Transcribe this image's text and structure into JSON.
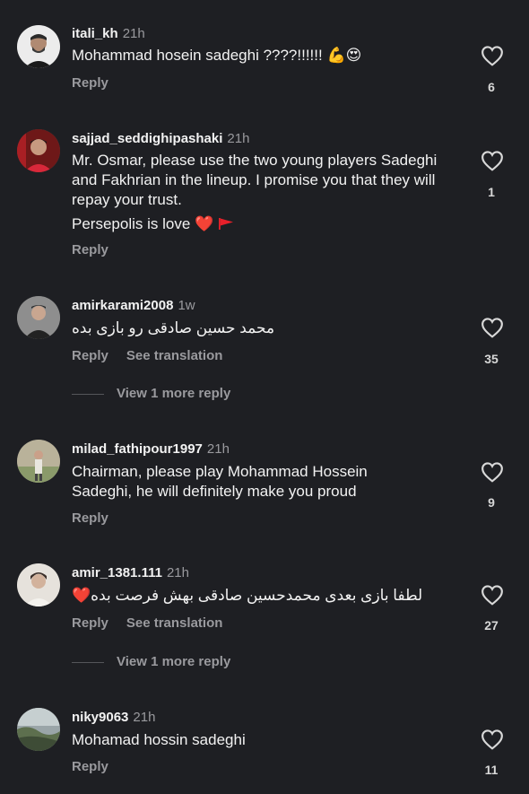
{
  "comments": [
    {
      "username": "itali_kh",
      "time": "21h",
      "text": "Mohammad hosein sadeghi ????!!!!!! 💪😍",
      "reply": "Reply",
      "likes": "6"
    },
    {
      "username": "sajjad_seddighipashaki",
      "time": "21h",
      "text": "Mr. Osmar, please use the two young players Sadeghi and Fakhrian in the lineup. I promise you that they will repay your trust.",
      "text2": "Persepolis is love ❤️",
      "reply": "Reply",
      "likes": "1"
    },
    {
      "username": "amirkarami2008",
      "time": "1w",
      "text": "محمد حسین صادقی رو بازی بده",
      "reply": "Reply",
      "see_translation": "See translation",
      "likes": "35",
      "view_more": "View 1 more reply"
    },
    {
      "username": "milad_fathipour1997",
      "time": "21h",
      "text": "Chairman, please play Mohammad Hossein Sadeghi, he will definitely make you proud",
      "reply": "Reply",
      "likes": "9"
    },
    {
      "username": "amir_1381.111",
      "time": "21h",
      "text": "لطفا بازی بعدی محمدحسین صادقی بهش فرصت بده❤️",
      "reply": "Reply",
      "see_translation": "See translation",
      "likes": "27",
      "view_more": "View 1 more reply"
    },
    {
      "username": "niky9063",
      "time": "21h",
      "text": "Mohamad hossin sadeghi",
      "reply": "Reply",
      "likes": "11"
    }
  ],
  "colors": {
    "background": "#1e1f23",
    "text": "#f2f2f2",
    "muted": "#9a9a9e",
    "heart_outline": "#d8d8d8",
    "red_heart": "#e0245e",
    "flag": "#e8202a"
  },
  "icons": {
    "heart": "heart-outline-icon",
    "flag": "red-flag-icon"
  }
}
